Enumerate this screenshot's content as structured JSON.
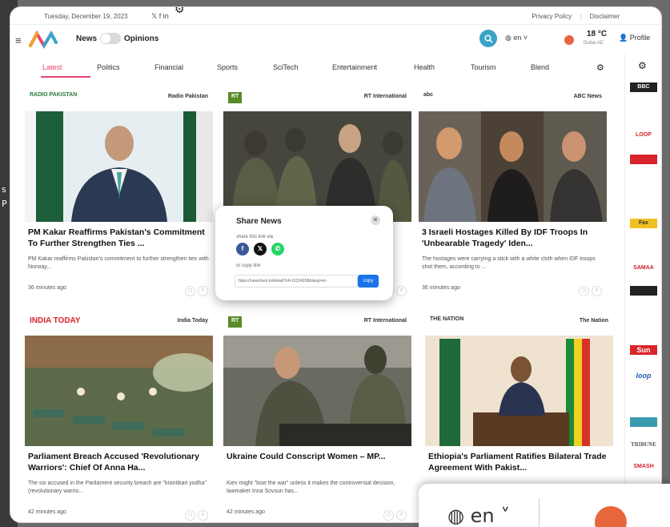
{
  "topbar": {
    "date": "Tuesday, December 19, 2023",
    "social": "𝕏  f  in",
    "privacy": "Privacy Policy",
    "disclaimer": "Disclaimer"
  },
  "header": {
    "news_label": "News",
    "opinions_label": "Opinions",
    "lang": "en",
    "temperature": "18 °C",
    "city": "Dubai AE",
    "profile": "Profile"
  },
  "tabs": [
    "Latest",
    "Politics",
    "Financial",
    "Sports",
    "SciTech",
    "Entertainment",
    "Health",
    "Tourism",
    "Blend"
  ],
  "cards": [
    {
      "source": "Radio Pakistan",
      "logo_text": "RADIO PAKISTAN",
      "title": "PM Kakar Reaffirms Pakistan's Commitment To Further Strengthen Ties ...",
      "desc": "PM Kakar reaffirms Pakistan's commitment to further strengthen ties with Norway...",
      "time": "36 minutes ago"
    },
    {
      "source": "RT International",
      "logo_text": "RT",
      "title": "",
      "desc": "",
      "time": ""
    },
    {
      "source": "ABC News",
      "logo_text": "abc",
      "title": "3 Israeli Hostages Killed By IDF Troops In 'Unbearable Tragedy' Iden...",
      "desc": "The hostages were carrying a stick with a white cloth when IDF troops shot them, according to ...",
      "time": "36 minutes ago"
    },
    {
      "source": "India Today",
      "logo_text": "INDIA TODAY",
      "title": "Parliament Breach Accused 'Revolutionary Warriors': Chief Of Anna Ha...",
      "desc": "The six accused in the Parliament security breach are \"krantikari yodha\" (revolutionary warrio...",
      "time": "42 minutes ago"
    },
    {
      "source": "RT International",
      "logo_text": "RT",
      "title": "Ukraine Could Conscript Women – MP...",
      "desc": "Kiev might \"lose the war\" unless it makes the controversial decision, lawmaker Inna Sovsun has...",
      "time": "42 minutes ago"
    },
    {
      "source": "The Nation",
      "logo_text": "THE NATION",
      "title": "Ethiopia's Parliament Ratifies Bilateral Trade Agreement With Pakist...",
      "desc": "",
      "time": ""
    }
  ],
  "share": {
    "title": "Share News",
    "via": "share this link via",
    "copy_label": "or copy link",
    "url": "https://newshunt.io/detail/?id=19224208&lang=en",
    "copy_btn": "copy"
  },
  "rail_logos": [
    "BBC",
    "",
    "LOOP",
    "",
    "",
    "",
    "Fax",
    "",
    "SAMAA",
    "",
    "",
    "",
    "Sun",
    "loop",
    "",
    "",
    "TRIBUNE",
    "SMASH"
  ],
  "bottom_popup": {
    "lang": "en"
  },
  "colors": {
    "accent": "#e8436e",
    "search": "#3aa3c7",
    "weather": "#e8663d"
  }
}
